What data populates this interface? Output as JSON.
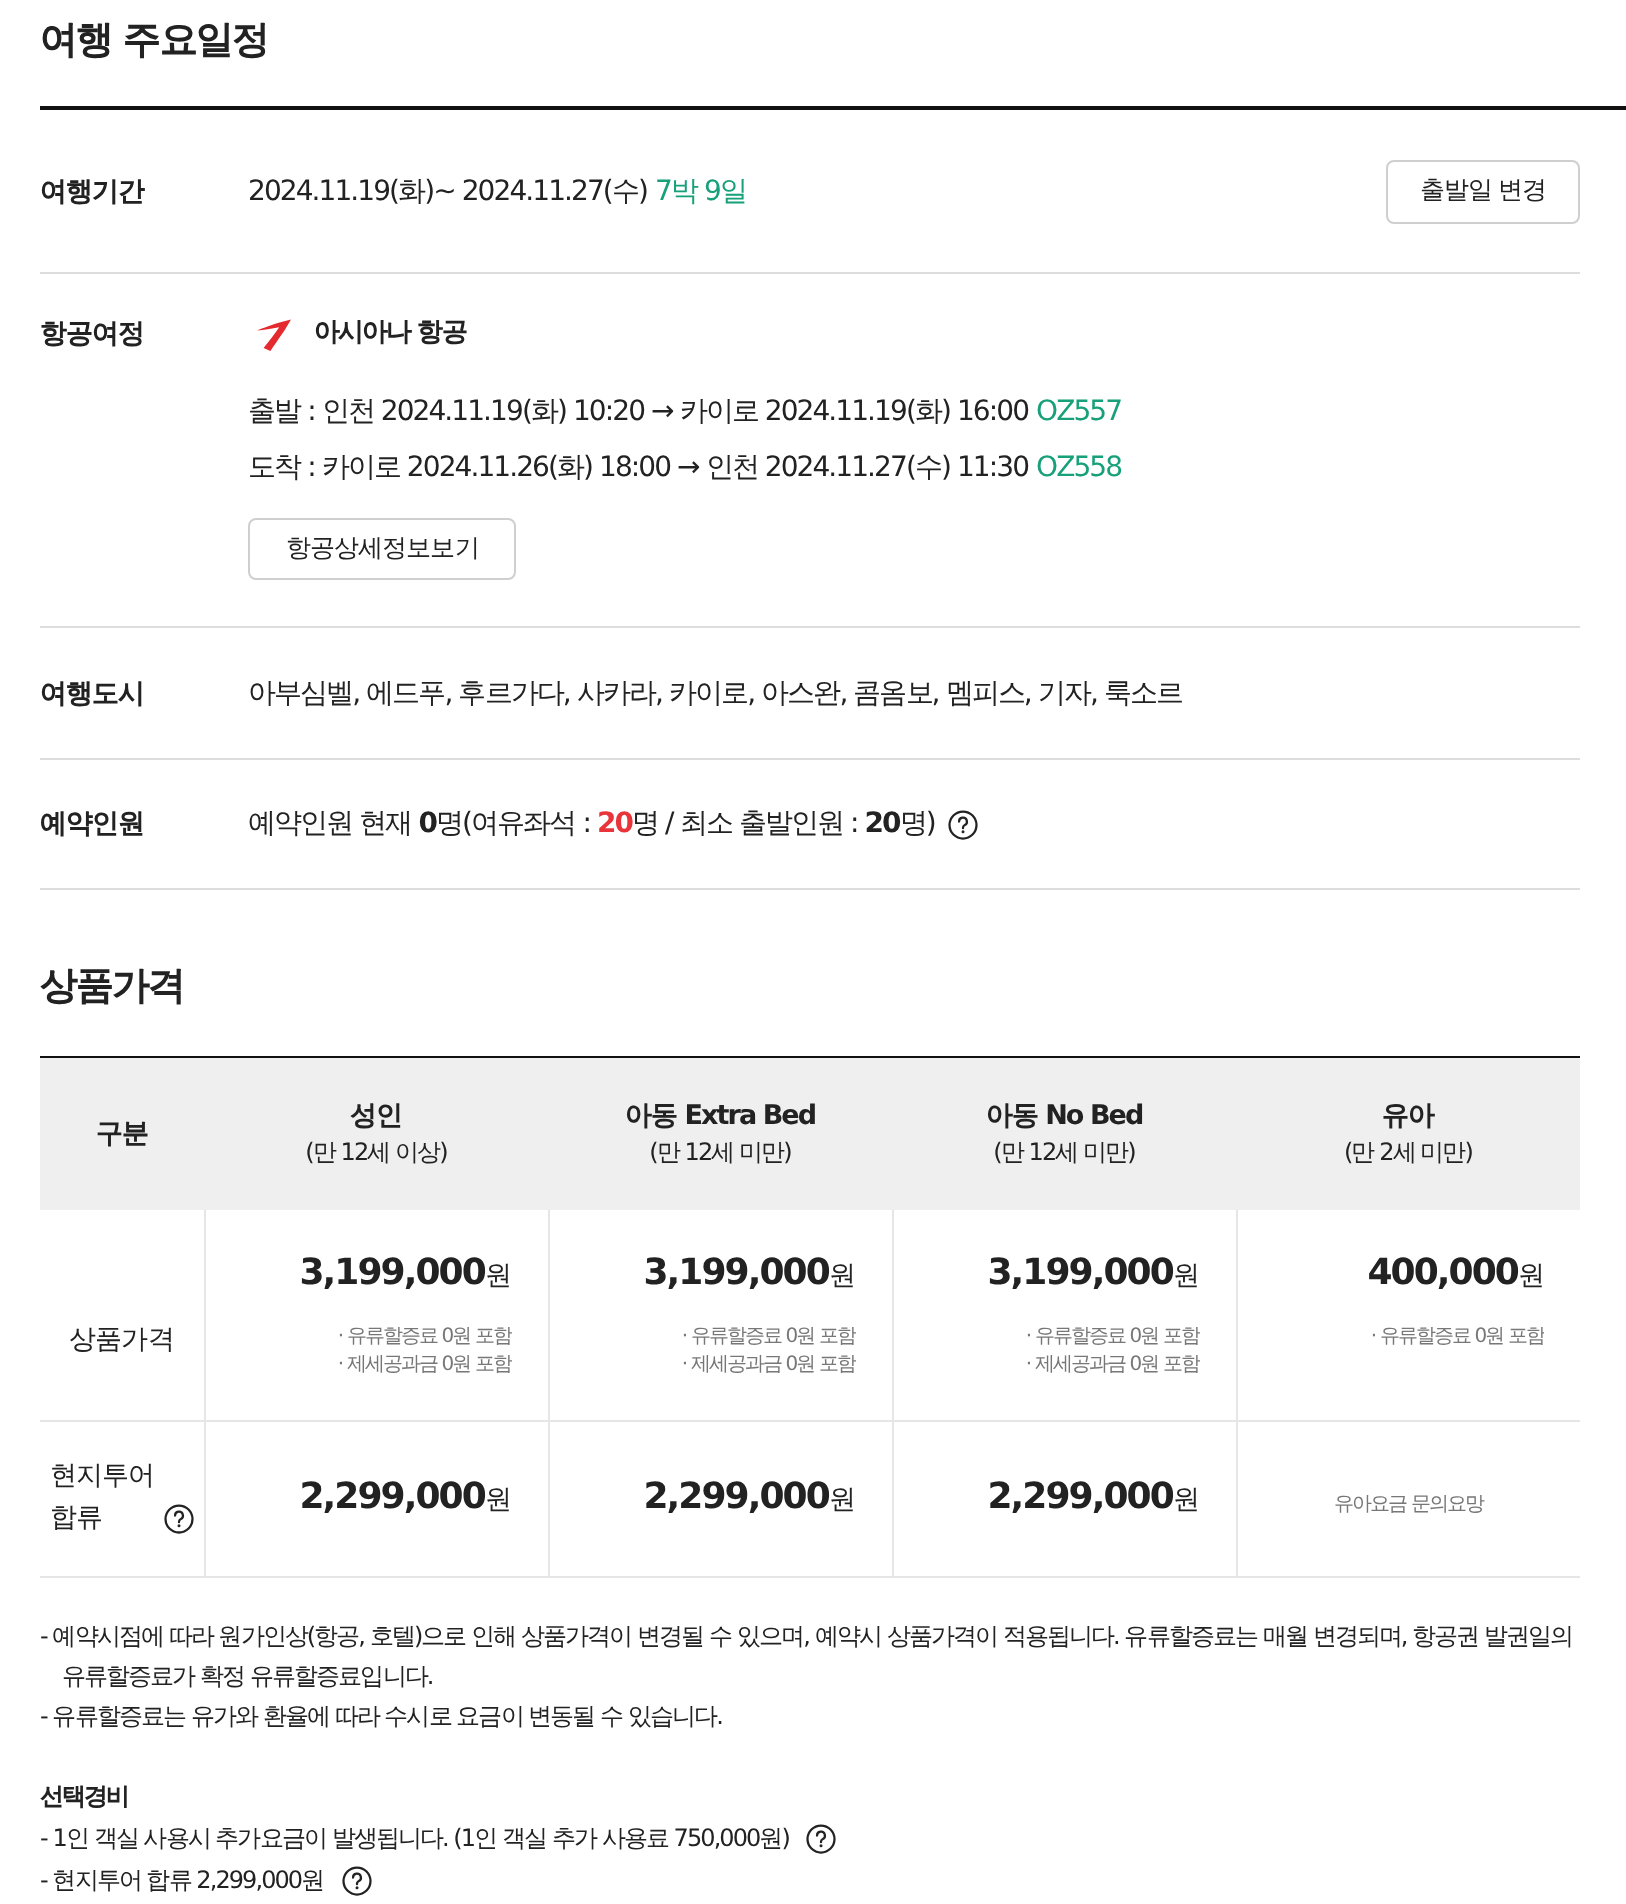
{
  "title": "여행 주요일정",
  "info_rows": [
    {
      "kind": "period",
      "label": "여행기간",
      "dates": "2024.11.19(화)~ 2024.11.27(수)",
      "duration": "7박 9일",
      "button": "출발일 변경"
    },
    {
      "kind": "flight",
      "label": "항공여정",
      "airline": "아시아나 항공",
      "legs": [
        {
          "text": "출발 : 인천 2024.11.19(화) 10:20 → 카이로 2024.11.19(화) 16:00",
          "flight_no": "OZ557"
        },
        {
          "text": "도착 : 카이로 2024.11.26(화) 18:00 → 인천 2024.11.27(수) 11:30",
          "flight_no": "OZ558"
        }
      ],
      "button": "항공상세정보보기"
    },
    {
      "kind": "cities",
      "label": "여행도시",
      "text": "아부심벨, 에드푸, 후르가다, 사카라, 카이로, 아스완, 콤옴보, 멤피스, 기자, 룩소르"
    },
    {
      "kind": "booking",
      "label": "예약인원",
      "segments": [
        {
          "kind": "plain",
          "text": "예약인원 현재 "
        },
        {
          "kind": "strong",
          "text": "0"
        },
        {
          "kind": "plain",
          "text": "명(여유좌석 : "
        },
        {
          "kind": "alert",
          "text": "20"
        },
        {
          "kind": "plain",
          "text": "명 / 최소 출발인원 : "
        },
        {
          "kind": "strong",
          "text": "20"
        },
        {
          "kind": "plain",
          "text": "명)"
        }
      ],
      "help": true
    }
  ],
  "price_table": {
    "title": "상품가격",
    "columns": [
      {
        "label": "구분"
      },
      {
        "label": "성인",
        "note": "(만 12세 이상)"
      },
      {
        "label": "아동 Extra Bed",
        "note": "(만 12세 미만)"
      },
      {
        "label": "아동 No Bed",
        "note": "(만 12세 미만)"
      },
      {
        "label": "유아",
        "note": "(만 2세 미만)"
      }
    ],
    "rows": [
      {
        "cells": [
          {
            "kind": "label",
            "text": "상품가격"
          },
          {
            "kind": "price",
            "amount": "3,199,000",
            "unit": "원",
            "notes": [
              "· 유류할증료 0원 포함",
              "· 제세공과금 0원 포함"
            ]
          },
          {
            "kind": "price",
            "amount": "3,199,000",
            "unit": "원",
            "notes": [
              "· 유류할증료 0원 포함",
              "· 제세공과금 0원 포함"
            ]
          },
          {
            "kind": "price",
            "amount": "3,199,000",
            "unit": "원",
            "notes": [
              "· 유류할증료 0원 포함",
              "· 제세공과금 0원 포함"
            ]
          },
          {
            "kind": "price",
            "amount": "400,000",
            "unit": "원",
            "notes": [
              "· 유류할증료 0원 포함"
            ]
          }
        ]
      },
      {
        "cells": [
          {
            "kind": "label",
            "text": "현지투어 합류",
            "help": true
          },
          {
            "kind": "price",
            "amount": "2,299,000",
            "unit": "원"
          },
          {
            "kind": "price",
            "amount": "2,299,000",
            "unit": "원"
          },
          {
            "kind": "price",
            "amount": "2,299,000",
            "unit": "원"
          },
          {
            "kind": "text",
            "text": "유아요금 문의요망"
          }
        ]
      }
    ]
  },
  "notes": [
    "- 예약시점에 따라 원가인상(항공, 호텔)으로 인해 상품가격이 변경될 수 있으며, 예약시 상품가격이 적용됩니다. 유류할증료는 매월 변경되며, 항공권 발권일의 유류할증료가 확정 유류할증료입니다.",
    "- 유류할증료는 유가와 환율에 따라 수시로 요금이 변동될 수 있습니다."
  ],
  "optional_costs": {
    "title": "선택경비",
    "items": [
      {
        "text": "- 1인 객실 사용시 추가요금이 발생됩니다. (1인 객실 추가 사용료 750,000원)",
        "help": true
      },
      {
        "text": "- 현지투어 합류 2,299,000원",
        "help": true
      }
    ]
  }
}
